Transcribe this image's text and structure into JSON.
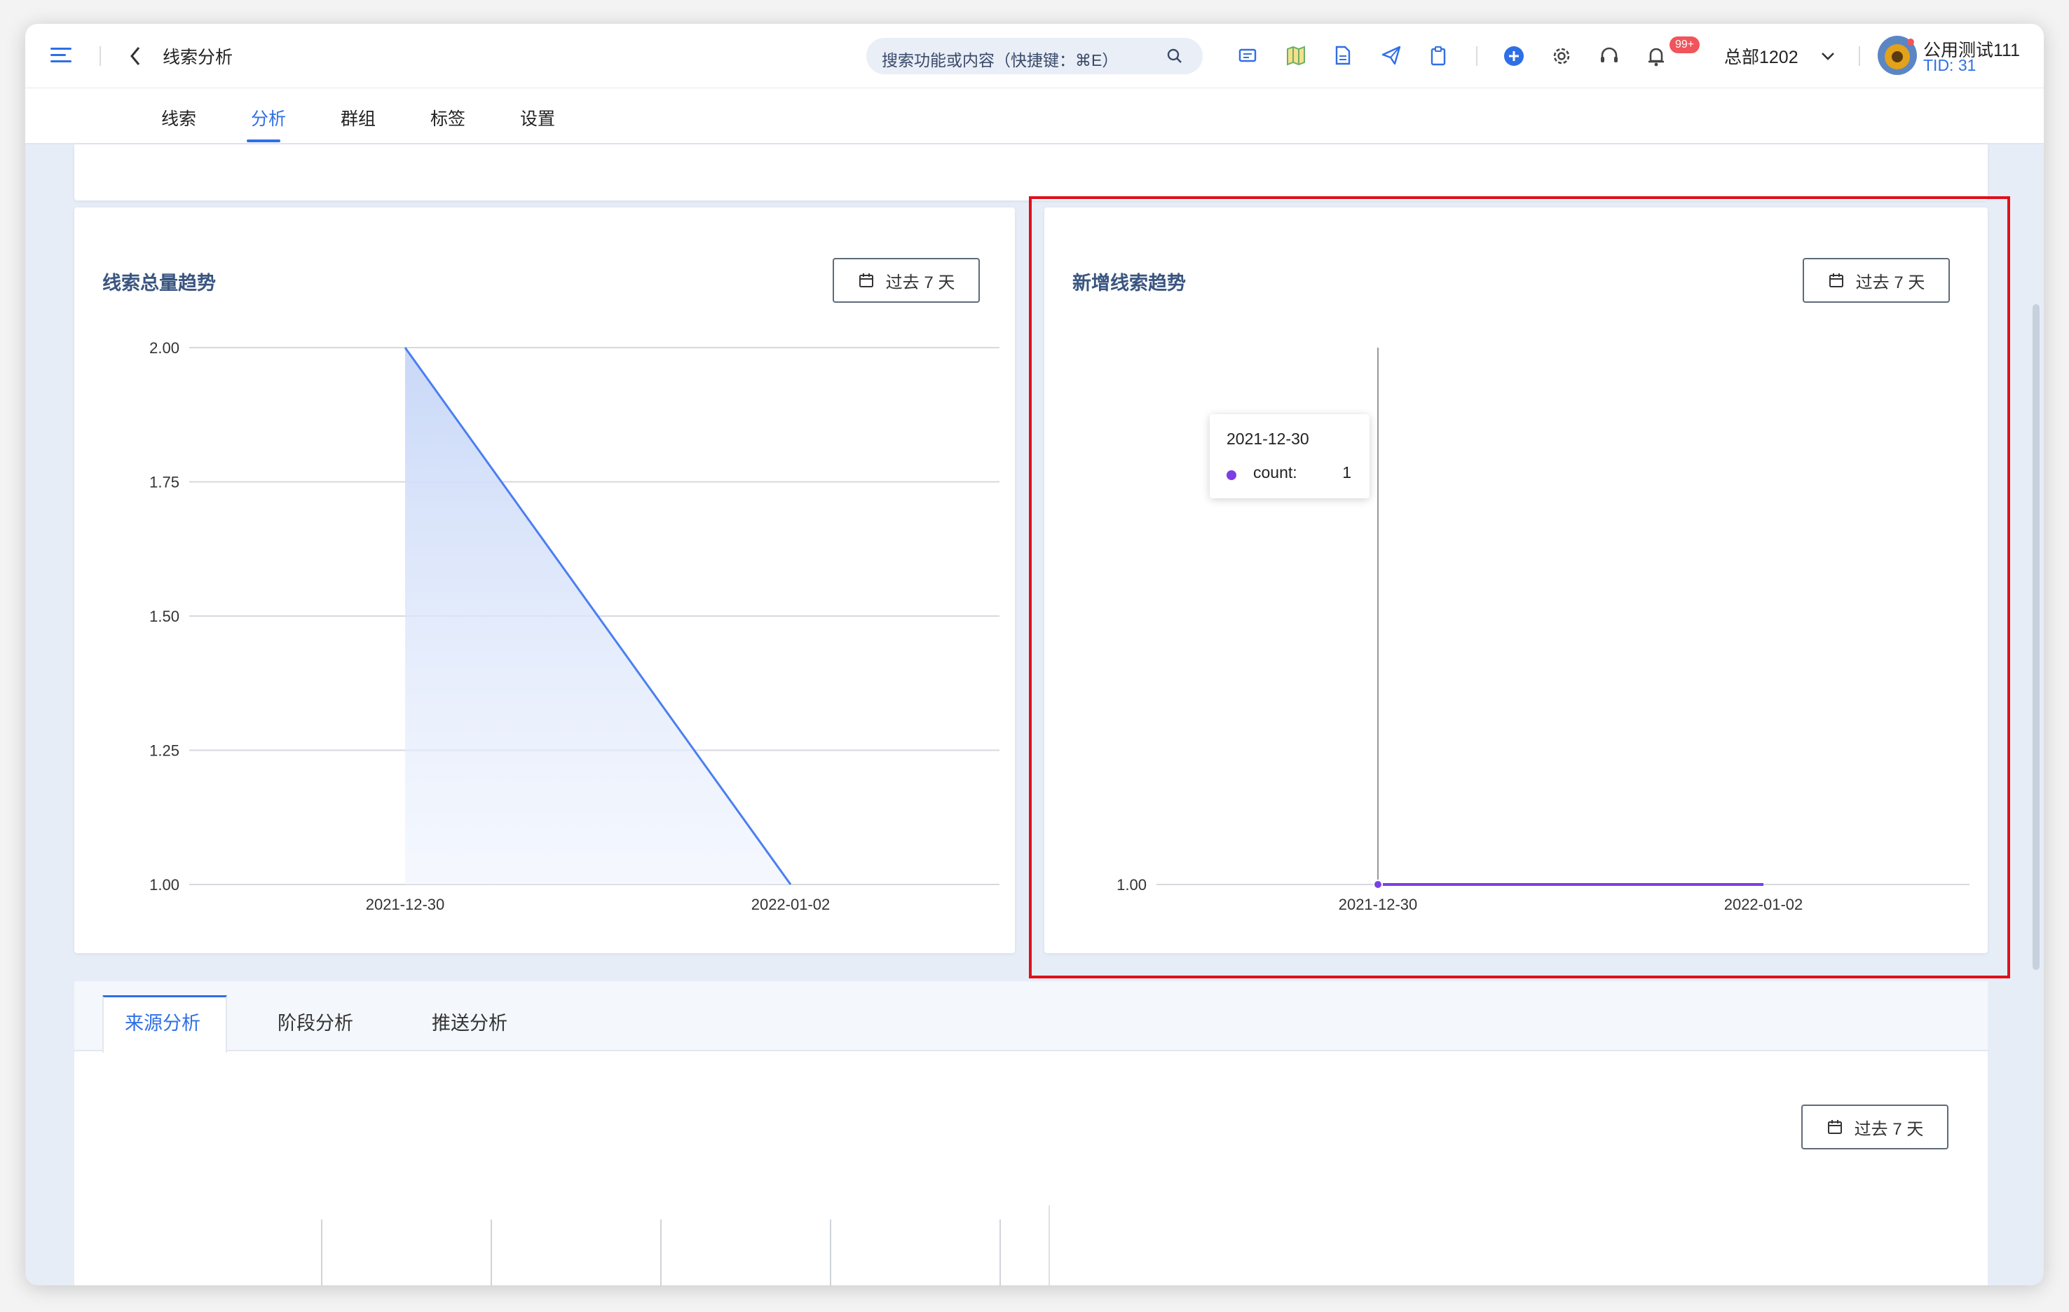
{
  "header": {
    "title": "线索分析",
    "search_placeholder": "搜索功能或内容（快捷键：⌘E）",
    "notification_badge": "99+",
    "org_name": "总部1202",
    "user_name": "公用测试111",
    "user_tid": "TID: 31"
  },
  "tabs": [
    {
      "label": "线索",
      "active": false
    },
    {
      "label": "分析",
      "active": true
    },
    {
      "label": "群组",
      "active": false
    },
    {
      "label": "标签",
      "active": false
    },
    {
      "label": "设置",
      "active": false
    }
  ],
  "cards": {
    "total_trend": {
      "title": "线索总量趋势",
      "date_range": "过去 7 天"
    },
    "new_trend": {
      "title": "新增线索趋势",
      "date_range": "过去 7 天"
    }
  },
  "tooltip": {
    "date": "2021-12-30",
    "label": "count:",
    "value": "1"
  },
  "bottom": {
    "tabs": [
      {
        "label": "来源分析",
        "active": true
      },
      {
        "label": "阶段分析",
        "active": false
      },
      {
        "label": "推送分析",
        "active": false
      }
    ],
    "date_range": "过去 7 天"
  },
  "colors": {
    "accent": "#2f6fe6",
    "series_purple": "#7b3fe4",
    "highlight_red": "#e0101a"
  },
  "chart_data": [
    {
      "type": "area",
      "title": "线索总量趋势",
      "x": [
        "2021-12-30",
        "2022-01-02"
      ],
      "series": [
        {
          "values": [
            2.0,
            1.0
          ]
        }
      ],
      "yticks": [
        "1.00",
        "1.25",
        "1.50",
        "1.75",
        "2.00"
      ],
      "ylim": [
        1.0,
        2.0
      ],
      "grid": true
    },
    {
      "type": "line",
      "title": "新增线索趋势",
      "x": [
        "2021-12-30",
        "2022-01-02"
      ],
      "series": [
        {
          "name": "count",
          "values": [
            1,
            1
          ]
        }
      ],
      "yticks": [
        "1.00"
      ],
      "ylim": [
        1.0,
        1.0
      ],
      "grid": true
    }
  ]
}
